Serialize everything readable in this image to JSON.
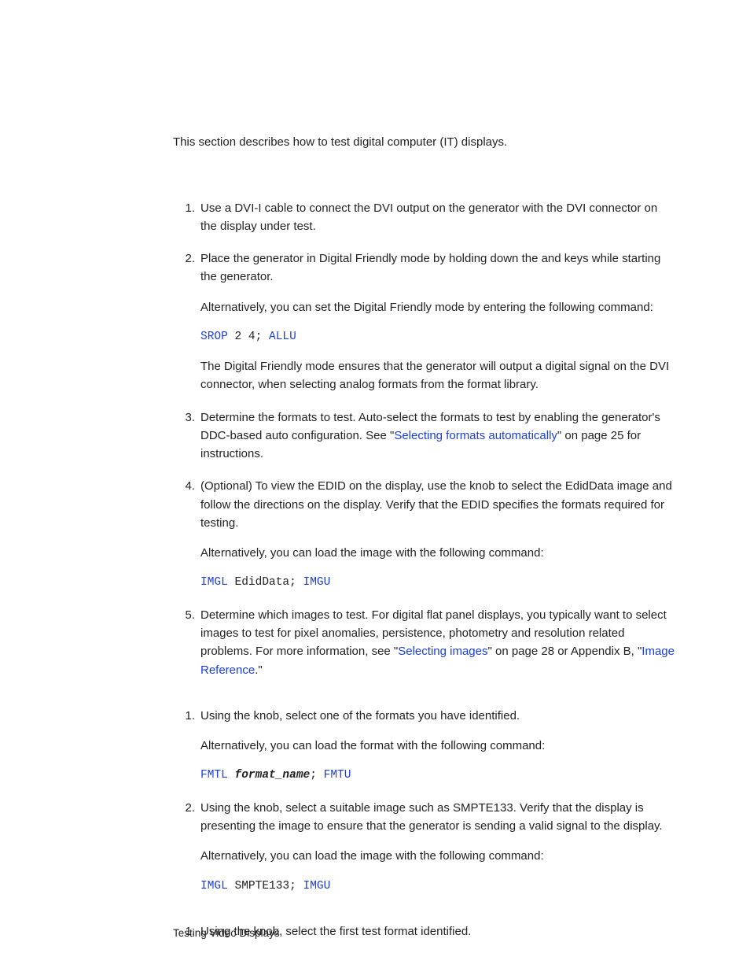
{
  "intro": "This section describes how to test digital computer (IT) displays.",
  "listA": [
    {
      "num": "1.",
      "body": [
        {
          "t": "text",
          "v": "Use a DVI-I cable to connect the DVI output on the generator with the DVI connector on the display under test."
        }
      ]
    },
    {
      "num": "2.",
      "body": [
        {
          "t": "text",
          "v": "Place the generator in Digital Friendly mode by holding down the       and       keys while starting the generator."
        }
      ],
      "subs": [
        [
          {
            "t": "text",
            "v": "Alternatively, you can set the Digital Friendly mode by entering the following command:"
          }
        ],
        [
          {
            "t": "mono",
            "pieces": [
              {
                "c": "cmd",
                "v": "SROP"
              },
              {
                "c": "",
                "v": " 2 4; "
              },
              {
                "c": "cmd",
                "v": "ALLU"
              }
            ]
          }
        ],
        [
          {
            "t": "text",
            "v": "The Digital Friendly mode ensures that the generator will output a digital signal on the DVI connector, when selecting analog formats from the format library."
          }
        ]
      ]
    },
    {
      "num": "3.",
      "body": [
        {
          "t": "text",
          "v": "Determine the formats to test. Auto-select the formats to test by enabling the generator's DDC-based auto configuration. See \""
        },
        {
          "t": "link",
          "v": "Selecting formats automatically"
        },
        {
          "t": "text",
          "v": "\" on page 25 for instructions."
        }
      ]
    },
    {
      "num": "4.",
      "body": [
        {
          "t": "text",
          "v": "(Optional) To view the EDID on the display, use the            knob to select the EdidData image and follow the directions on the display. Verify that the EDID specifies the formats required for testing."
        }
      ],
      "subs": [
        [
          {
            "t": "text",
            "v": "Alternatively, you can load the image with the following command:"
          }
        ],
        [
          {
            "t": "mono",
            "pieces": [
              {
                "c": "cmd",
                "v": "IMGL"
              },
              {
                "c": "",
                "v": " EdidData; "
              },
              {
                "c": "cmd",
                "v": "IMGU"
              }
            ]
          }
        ]
      ]
    },
    {
      "num": "5.",
      "body": [
        {
          "t": "text",
          "v": "Determine which images to test. For digital flat panel displays, you typically want to select images to test for pixel anomalies, persistence, photometry and resolution related problems. For more information, see \""
        },
        {
          "t": "link",
          "v": "Selecting images"
        },
        {
          "t": "text",
          "v": "\" on page 28 or Appendix B, \""
        },
        {
          "t": "link",
          "v": "Image Reference"
        },
        {
          "t": "text",
          "v": ".\""
        }
      ]
    }
  ],
  "listB": [
    {
      "num": "1.",
      "body": [
        {
          "t": "text",
          "v": "Using the               knob, select one of the formats you have identified."
        }
      ],
      "subs": [
        [
          {
            "t": "text",
            "v": "Alternatively, you can load the format with the following command:"
          }
        ],
        [
          {
            "t": "mono",
            "pieces": [
              {
                "c": "cmd",
                "v": "FMTL"
              },
              {
                "c": "",
                "v": " "
              },
              {
                "c": "boldi",
                "v": "format_name"
              },
              {
                "c": "",
                "v": "; "
              },
              {
                "c": "cmd",
                "v": "FMTU"
              }
            ]
          }
        ]
      ]
    },
    {
      "num": "2.",
      "body": [
        {
          "t": "text",
          "v": "Using the               knob, select a suitable image such as SMPTE133. Verify that the display is presenting the image to ensure that the generator is sending a valid signal to the display."
        }
      ],
      "subs": [
        [
          {
            "t": "text",
            "v": "Alternatively, you can load the image with the following command:"
          }
        ],
        [
          {
            "t": "mono",
            "pieces": [
              {
                "c": "cmd",
                "v": "IMGL"
              },
              {
                "c": "",
                "v": " SMPTE133; "
              },
              {
                "c": "cmd",
                "v": "IMGU"
              }
            ]
          }
        ]
      ]
    }
  ],
  "listC": [
    {
      "num": "1.",
      "body": [
        {
          "t": "text",
          "v": "Using the               knob, select the first test format identified."
        }
      ]
    }
  ],
  "footer": "Testing Video Displays"
}
